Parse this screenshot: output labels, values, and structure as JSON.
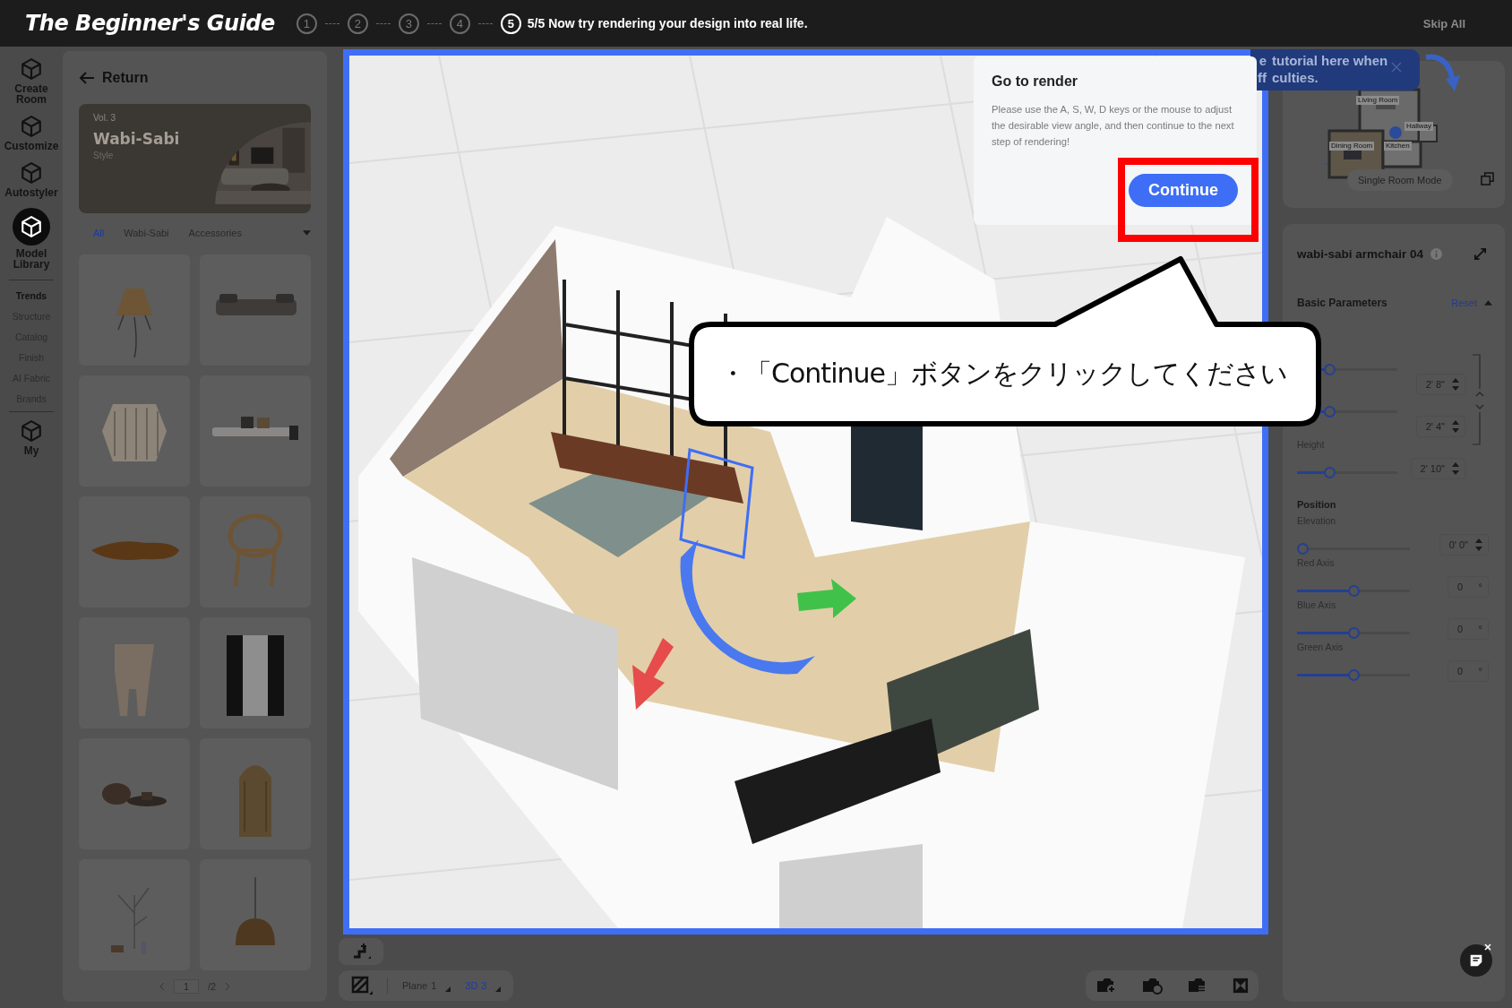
{
  "guide": {
    "title": "The Beginner's Guide",
    "steps": [
      {
        "number": "1",
        "current": false
      },
      {
        "number": "2",
        "current": false
      },
      {
        "number": "3",
        "current": false
      },
      {
        "number": "4",
        "current": false
      },
      {
        "number": "5",
        "current": true
      }
    ],
    "step_text": "5/5 Now try rendering your design into real life.",
    "skip": "Skip All"
  },
  "rail": {
    "items": [
      {
        "kind": "tool",
        "label": "Create Room",
        "selected": false
      },
      {
        "kind": "tool",
        "label": "Customize",
        "selected": false
      },
      {
        "kind": "tool",
        "label": "Autostyler",
        "selected": false
      },
      {
        "kind": "tool",
        "label": "Model Library",
        "selected": true
      },
      {
        "kind": "sub",
        "label": "Trends",
        "selected": true
      },
      {
        "kind": "sub",
        "label": "Structure",
        "selected": false
      },
      {
        "kind": "sub",
        "label": "Catalog",
        "selected": false
      },
      {
        "kind": "sub",
        "label": "Finish",
        "selected": false
      },
      {
        "kind": "sub",
        "label": "AI Fabric",
        "selected": false
      },
      {
        "kind": "sub",
        "label": "Brands",
        "selected": false
      },
      {
        "kind": "tool",
        "label": "My",
        "selected": false
      }
    ]
  },
  "library": {
    "back": "Return",
    "banner": {
      "volume": "Vol. 3",
      "title": "Wabi-Sabi",
      "subtitle": "Style"
    },
    "tabs": [
      {
        "label": "All",
        "selected": true
      },
      {
        "label": "Wabi-Sabi",
        "selected": false
      },
      {
        "label": "Accessories",
        "selected": false
      }
    ],
    "pagination": {
      "page": "1",
      "total": "/2"
    }
  },
  "view_modes": [
    {
      "label": "Plane",
      "count": "1",
      "selected": false
    },
    {
      "label": "3D",
      "count": "3",
      "selected": true
    }
  ],
  "tutorial_tip": {
    "lines": [
      {
        "cut": "e",
        "text": "tutorial here when"
      },
      {
        "cut": "ff",
        "text": "culties."
      }
    ]
  },
  "dialog": {
    "title": "Go to render",
    "message": "Please use the A, S, W, D keys or the mouse to adjust the desirable view angle, and then continue to the next step of rendering!",
    "button": "Continue"
  },
  "callout": {
    "text": "・「Continue」ボタンをクリックしてください"
  },
  "minimap": {
    "rooms": [
      "Living Room",
      "Hallway",
      "Dining Room",
      "Kitchen"
    ],
    "mode_button": "Single Room Mode"
  },
  "properties": {
    "title": "wabi-sabi armchair 04",
    "section": "Basic Parameters",
    "reset": "Reset",
    "size": [
      {
        "value": "2' 8\"",
        "level": 0.3
      },
      {
        "value": "2' 4\"",
        "level": 0.3
      },
      {
        "label": "Height",
        "value": "2' 10\"",
        "level": 0.3
      }
    ],
    "position_title": "Position",
    "position": [
      {
        "kind": "length",
        "label": "Elevation",
        "value": "0' 0\"",
        "level": 0
      },
      {
        "kind": "angle",
        "label": "Red Axis",
        "value": "0",
        "unit": "°",
        "level": 0.5
      },
      {
        "kind": "angle",
        "label": "Blue Axis",
        "value": "0",
        "unit": "°",
        "level": 0.5
      },
      {
        "kind": "angle",
        "label": "Green Axis",
        "value": "0",
        "unit": "°",
        "level": 0.5
      }
    ]
  }
}
